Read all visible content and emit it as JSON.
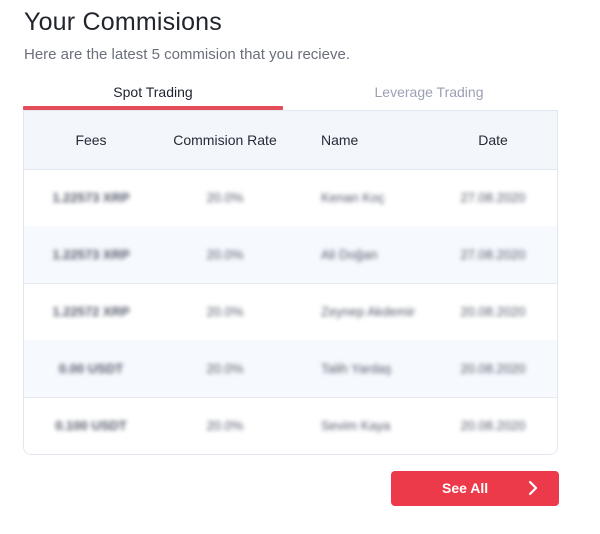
{
  "header": {
    "title": "Your Commisions",
    "subtitle": "Here are the latest 5 commision that you recieve."
  },
  "tabs": [
    {
      "label": "Spot Trading",
      "active": true
    },
    {
      "label": "Leverage Trading",
      "active": false
    }
  ],
  "table": {
    "columns": [
      "Fees",
      "Commision Rate",
      "Name",
      "Date"
    ],
    "rows": [
      {
        "fees": "1.22573 XRP",
        "rate": "20.0%",
        "name": "Kenan Koç",
        "date": "27.08.2020"
      },
      {
        "fees": "1.22573 XRP",
        "rate": "20.0%",
        "name": "Ali Doğan",
        "date": "27.08.2020"
      },
      {
        "fees": "1.22572 XRP",
        "rate": "20.0%",
        "name": "Zeynep Akdemir",
        "date": "20.08.2020"
      },
      {
        "fees": "0.00 USDT",
        "rate": "20.0%",
        "name": "Talih Yardaş",
        "date": "20.08.2020"
      },
      {
        "fees": "0.100 USDT",
        "rate": "20.0%",
        "name": "Sevim Kaya",
        "date": "20.08.2020"
      }
    ]
  },
  "footer": {
    "see_all_label": "See All",
    "icon": "chevron-right-icon"
  },
  "colors": {
    "accent": "#ec3a4b",
    "tab_underline": "#e54c5a",
    "header_bg": "#f3f7fc",
    "alt_row_bg": "#f6f9fd"
  }
}
